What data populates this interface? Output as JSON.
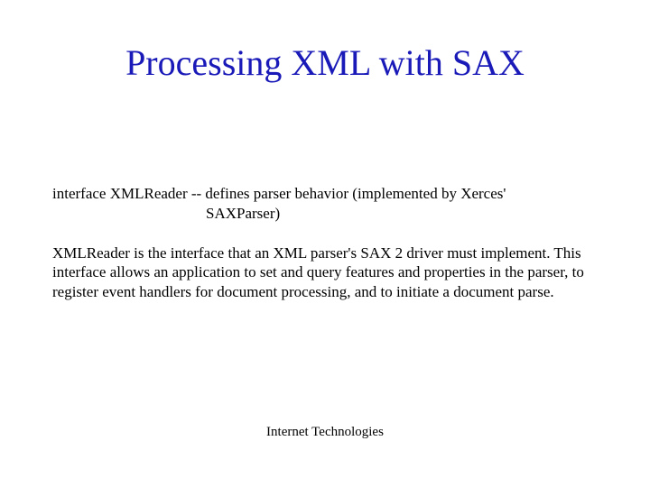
{
  "title": "Processing XML with SAX",
  "block1": {
    "line1": "interface XMLReader  -- defines parser behavior (implemented by Xerces'",
    "line2": "SAXParser)"
  },
  "block2": "XMLReader is the interface that an XML parser's SAX 2 driver must implement. This interface allows an application to set and query features and properties in the parser, to register event handlers for document processing, and to initiate a document parse.",
  "footer": "Internet Technologies"
}
